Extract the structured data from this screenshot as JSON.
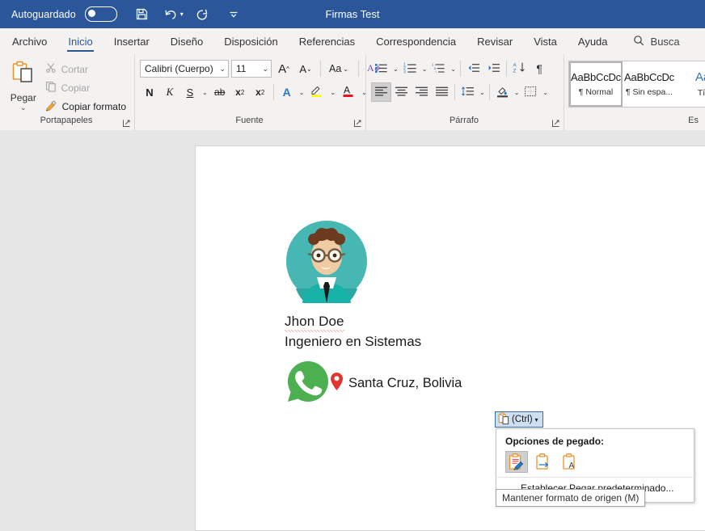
{
  "titlebar": {
    "autosave_label": "Autoguardado",
    "autosave_state": "off",
    "document_title": "Firmas Test",
    "save_icon": "save-icon",
    "undo_icon": "undo-icon",
    "redo_icon": "redo-icon",
    "customize_icon": "customize-quick-access-icon",
    "accent_color": "#2b579a"
  },
  "tabs": [
    {
      "label": "Archivo",
      "active": false
    },
    {
      "label": "Inicio",
      "active": true
    },
    {
      "label": "Insertar",
      "active": false
    },
    {
      "label": "Diseño",
      "active": false
    },
    {
      "label": "Disposición",
      "active": false
    },
    {
      "label": "Referencias",
      "active": false
    },
    {
      "label": "Correspondencia",
      "active": false
    },
    {
      "label": "Revisar",
      "active": false
    },
    {
      "label": "Vista",
      "active": false
    },
    {
      "label": "Ayuda",
      "active": false
    }
  ],
  "search": {
    "icon": "search-icon",
    "text": "Busca"
  },
  "ribbon": {
    "clipboard": {
      "group_label": "Portapapeles",
      "paste_label": "Pegar",
      "items": [
        {
          "label": "Cortar",
          "icon": "scissors-icon",
          "enabled": false
        },
        {
          "label": "Copiar",
          "icon": "copy-icon",
          "enabled": false
        },
        {
          "label": "Copiar formato",
          "icon": "format-painter-icon",
          "enabled": true
        }
      ]
    },
    "font": {
      "group_label": "Fuente",
      "font_name": "Calibri (Cuerpo)",
      "font_size": "11",
      "grow_font": "A",
      "shrink_font": "A",
      "change_case": "Aa",
      "clear_formatting_icon": "clear-formatting-icon",
      "bold": "N",
      "italic": "K",
      "underline": "S",
      "strikethrough": "ab",
      "subscript": "x",
      "superscript": "x",
      "text_effects": "A",
      "highlight": "A",
      "font_color": "A",
      "highlight_color": "#ffff00",
      "font_color_value": "#e81123"
    },
    "paragraph": {
      "group_label": "Párrafo",
      "bullets_icon": "bullet-list-icon",
      "numbering_icon": "numbered-list-icon",
      "multilevel_icon": "multilevel-list-icon",
      "decrease_indent_icon": "decrease-indent-icon",
      "increase_indent_icon": "increase-indent-icon",
      "sort_icon": "sort-az-icon",
      "show_marks_icon": "pilcrow-icon",
      "align_left_icon": "align-left-icon",
      "align_center_icon": "align-center-icon",
      "align_right_icon": "align-right-icon",
      "justify_icon": "justify-icon",
      "line_spacing_icon": "line-spacing-icon",
      "shading_icon": "shading-icon",
      "borders_icon": "borders-icon"
    },
    "styles": {
      "group_label": "Es",
      "items": [
        {
          "sample": "AaBbCcDc",
          "name": "¶ Normal",
          "selected": true,
          "heading": false
        },
        {
          "sample": "AaBbCcDc",
          "name": "¶ Sin espa...",
          "selected": false,
          "heading": false
        },
        {
          "sample": "Aa",
          "name": "Tít",
          "selected": false,
          "heading": true
        }
      ]
    }
  },
  "document": {
    "signature": {
      "avatar_icon": "person-avatar-icon",
      "name": "Jhon Doe",
      "name_misspelled": true,
      "role": "Ingeniero en Sistemas",
      "whatsapp_icon": "whatsapp-icon",
      "location_pin_icon": "location-pin-icon",
      "location": "Santa Cruz, Bolivia"
    }
  },
  "paste_options": {
    "button_label": "(Ctrl)",
    "button_icon": "paste-clipboard-icon",
    "popup_header": "Opciones de pegado:",
    "icons": [
      {
        "name": "keep-source-formatting-icon",
        "hovered": true
      },
      {
        "name": "merge-formatting-icon",
        "hovered": false
      },
      {
        "name": "keep-text-only-icon",
        "hovered": false
      }
    ],
    "menu_item": "Establecer Pegar predeterminado...",
    "tooltip": "Mantener formato de origen (M)"
  }
}
